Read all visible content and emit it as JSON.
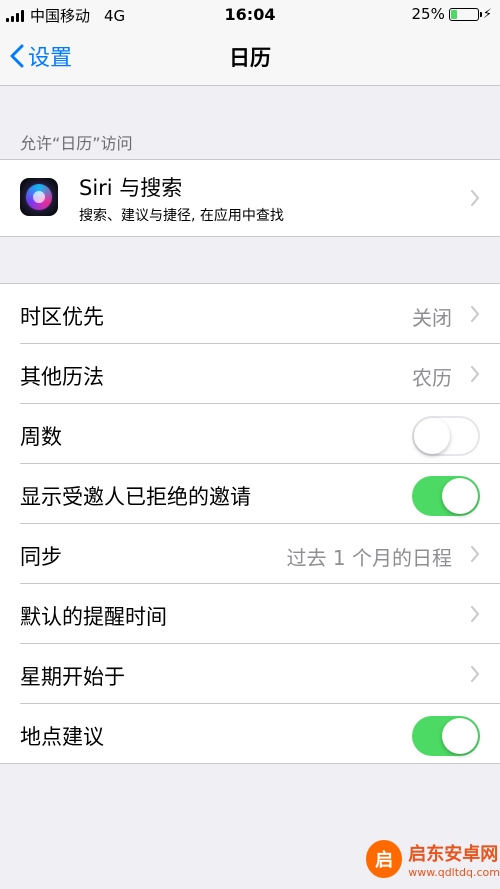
{
  "status_bar": {
    "carrier": "中国移动",
    "network": "4G",
    "time": "16:04",
    "battery_percent": "25%",
    "battery_level": 0.25
  },
  "nav": {
    "back_label": "设置",
    "title": "日历"
  },
  "section_header": "允许“日历”访问",
  "siri": {
    "title": "Siri 与搜索",
    "subtitle": "搜索、建议与捷径, 在应用中查找"
  },
  "rows": [
    {
      "label": "时区优先",
      "value": "关闭"
    },
    {
      "label": "其他历法",
      "value": "农历"
    },
    {
      "label": "周数",
      "toggle": false
    },
    {
      "label": "显示受邀人已拒绝的邀请",
      "toggle": true
    },
    {
      "label": "同步",
      "value": "过去 1 个月的日程"
    },
    {
      "label": "默认的提醒时间",
      "value": ""
    },
    {
      "label": "星期开始于",
      "value": ""
    },
    {
      "label": "地点建议",
      "toggle": true
    }
  ],
  "watermark": {
    "logo_char": "启",
    "name": "启东安卓网",
    "url": "www.qdltdq.com"
  },
  "colors": {
    "accent": "#007aff",
    "toggle_on": "#4cd964",
    "secondary_text": "#8e8e93",
    "background": "#efeff4"
  }
}
